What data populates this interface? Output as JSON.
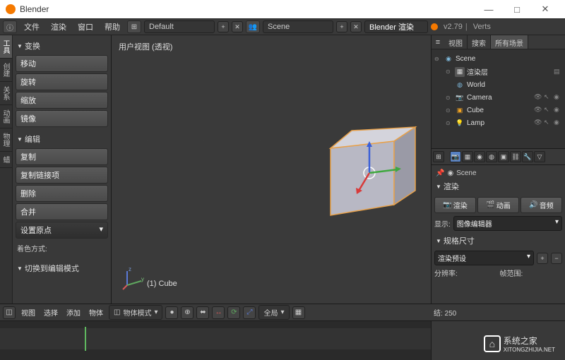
{
  "window": {
    "title": "Blender",
    "minimize": "—",
    "maximize": "□",
    "close": "✕"
  },
  "menubar": {
    "file": "文件",
    "render": "渲染",
    "window": "窗口",
    "help": "帮助",
    "layout": "Default",
    "scene": "Scene",
    "engine": "Blender 渲染",
    "version": "v2.79",
    "stats": "Verts"
  },
  "vtabs": [
    "工具",
    "创建",
    "关系",
    "动画",
    "物理",
    "蜡"
  ],
  "toolpanel": {
    "transform_header": "变换",
    "translate": "移动",
    "rotate": "旋转",
    "scale": "缩放",
    "mirror": "镜像",
    "edit_header": "编辑",
    "duplicate": "复制",
    "duplicate_linked": "复制链接项",
    "delete": "删除",
    "join": "合并",
    "set_origin": "设置原点",
    "shading": "着色方式:",
    "switch_mode": "切换到编辑模式"
  },
  "viewport": {
    "label": "用户视图 (透视)",
    "object": "(1) Cube"
  },
  "vp_header": {
    "view": "视图",
    "select": "选择",
    "add": "添加",
    "object": "物体",
    "mode": "物体模式",
    "global": "全局"
  },
  "outliner": {
    "tabs": {
      "view": "视图",
      "search": "搜索",
      "all_scenes": "所有场景"
    },
    "scene": "Scene",
    "render_layer": "渲染层",
    "world": "World",
    "camera": "Camera",
    "cube": "Cube",
    "lamp": "Lamp"
  },
  "properties": {
    "scene_crumb": "Scene",
    "render_header": "渲染",
    "render_btn": "渲染",
    "anim_btn": "动画",
    "audio_btn": "音频",
    "display_label": "显示:",
    "display_value": "图像编辑器",
    "dimensions_header": "规格尺寸",
    "preset": "渲染预设",
    "resolution": "分辨率:",
    "frame_range": "帧范围:",
    "end": "结: 250"
  },
  "watermark": {
    "text1": "系统之家",
    "text2": "XITONGZHIJIA.NET"
  }
}
